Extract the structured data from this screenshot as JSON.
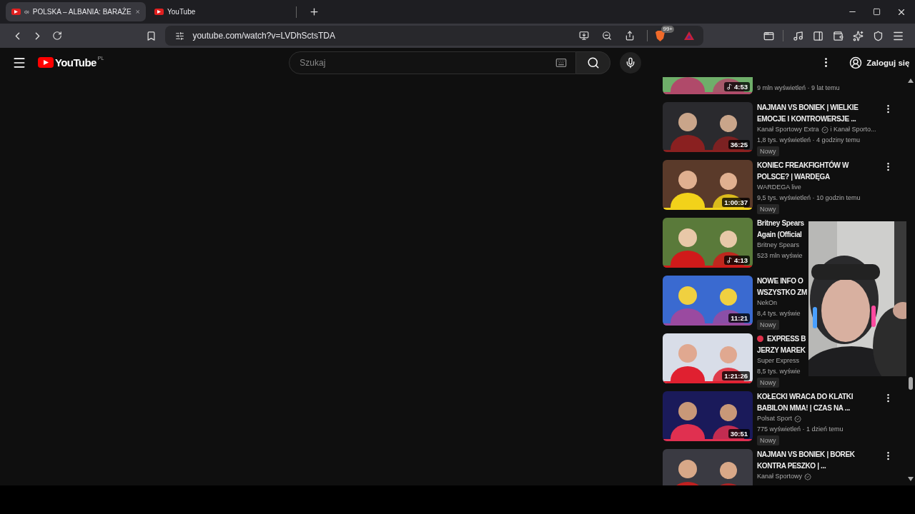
{
  "browser": {
    "tabs": [
      {
        "title": "POLSKA – ALBANIA: BARAŻE",
        "selected": true,
        "audio": true
      },
      {
        "title": "YouTube",
        "selected": false,
        "audio": false
      }
    ],
    "url": "youtube.com/watch?v=LVDhSctsTDA",
    "shields_badge": "99+"
  },
  "youtube": {
    "logo": "YouTube",
    "region": "PL",
    "search": {
      "placeholder": "Szukaj"
    },
    "sign_in": "Zaloguj się"
  },
  "related_videos": [
    {
      "meta": "9 mln wyświetleń · 9 lat temu",
      "duration": "4:53",
      "music": true
    },
    {
      "title": [
        "NAJMAN VS BONIEK | WIELKIE",
        "EMOCJE I KONTROWERSJE ..."
      ],
      "channel": "Kanał Sportowy Extra",
      "verified": true,
      "channel_extra": "i Kanał Sporto...",
      "meta": "1,8 tys. wyświetleń · 4 godziny temu",
      "badge": "Nowy",
      "duration": "36:25",
      "music": false,
      "more_button": true
    },
    {
      "title": [
        "KONIEC FREAKFIGHTÓW W",
        "POLSCE? | WARDĘGA"
      ],
      "channel": "WARDEGA live",
      "verified": false,
      "meta": "9,5 tys. wyświetleń · 10 godzin temu",
      "badge": "Nowy",
      "duration": "1:00:37",
      "music": false,
      "more_button": true
    },
    {
      "title": [
        "Britney Spears",
        "Again (Official"
      ],
      "channel": "Britney Spears",
      "meta": "523 mln wyświe",
      "duration": "4:13",
      "music": true
    },
    {
      "title": [
        "NOWE INFO O",
        "WSZYSTKO ZM"
      ],
      "channel": "NekOn",
      "verified": false,
      "meta": "8,4 tys. wyświe",
      "badge": "Nowy",
      "duration": "11:21",
      "music": false
    },
    {
      "live": true,
      "title": [
        "EXPRESS B",
        "JERZY MAREK"
      ],
      "channel": "Super Express",
      "meta": "8,5 tys. wyświe",
      "badge": "Nowy",
      "duration": "1:21:26",
      "music": false
    },
    {
      "title": [
        "KOŁECKI WRACA DO KLATKI",
        "BABILON MMA! | CZAS NA ..."
      ],
      "channel": "Polsat Sport",
      "verified": true,
      "meta": "775 wyświetleń · 1 dzień temu",
      "badge": "Nowy",
      "duration": "30:51",
      "music": false,
      "more_button": true
    },
    {
      "title": [
        "NAJMAN VS BONIEK | BOREK",
        "KONTRA PESZKO | ..."
      ],
      "channel": "Kanał Sportowy",
      "verified": true,
      "more_button": true
    }
  ]
}
